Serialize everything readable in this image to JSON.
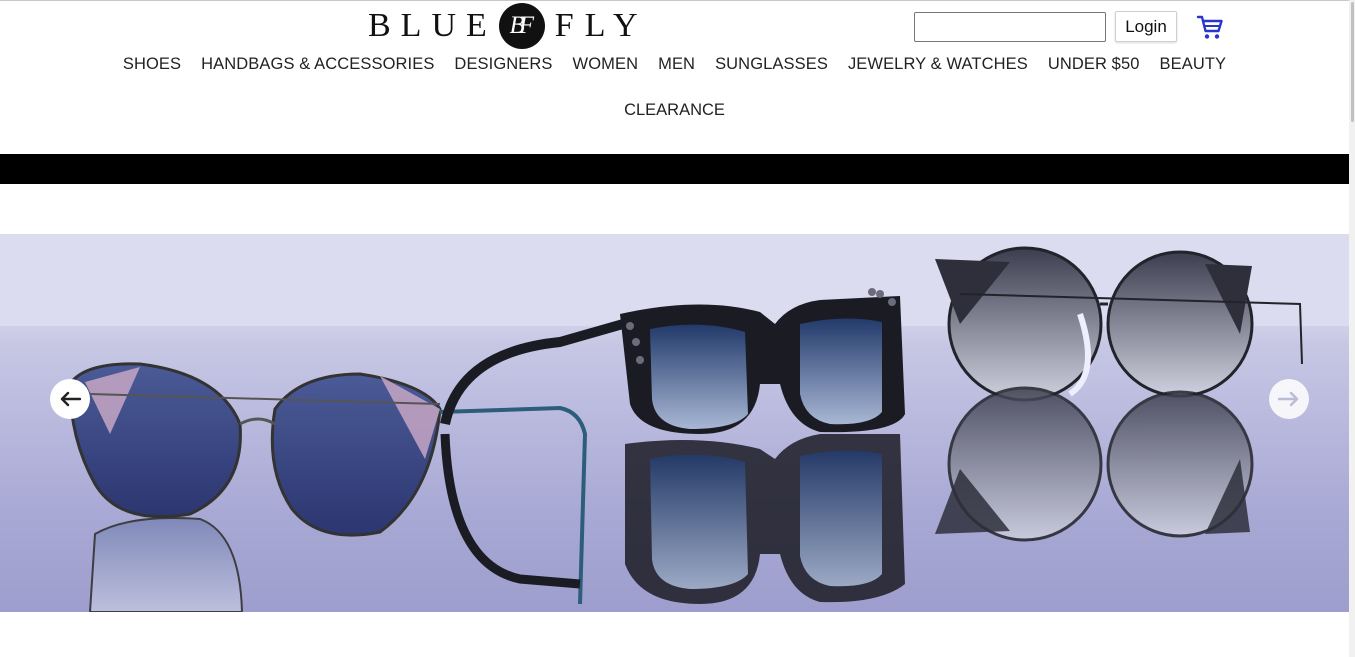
{
  "brand": {
    "left_word": "BLUE",
    "monogram": "BF",
    "right_word": "FLY"
  },
  "header": {
    "search_value": "",
    "login_label": "Login",
    "cart_icon": "shopping-cart-icon",
    "cart_color": "#2a35c9"
  },
  "nav": {
    "items": [
      "SHOES",
      "HANDBAGS & ACCESSORIES",
      "DESIGNERS",
      "WOMEN",
      "MEN",
      "SUNGLASSES",
      "JEWELRY & WATCHES",
      "UNDER $50",
      "BEAUTY"
    ],
    "second_row": [
      "CLEARANCE"
    ]
  },
  "hero": {
    "image": "sunglasses-banner",
    "prev_icon": "arrow-left-icon",
    "next_icon": "arrow-right-icon"
  }
}
